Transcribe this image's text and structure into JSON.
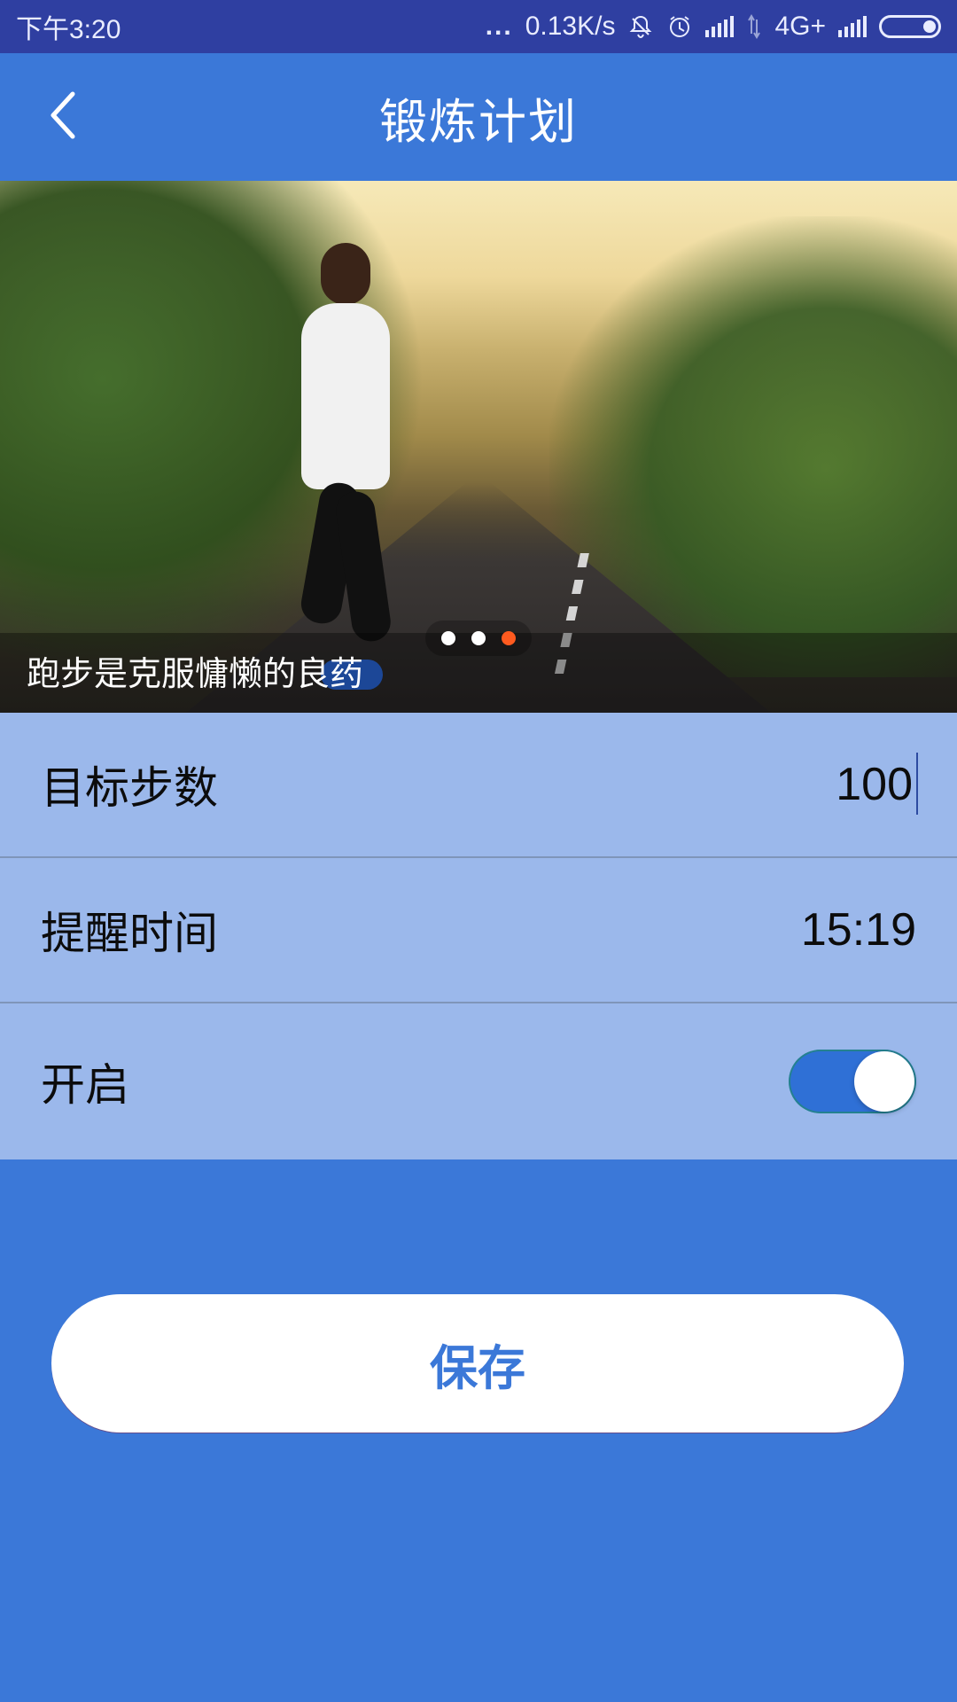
{
  "status_bar": {
    "time": "下午3:20",
    "more": "...",
    "speed": "0.13K/s",
    "network": "4G+"
  },
  "header": {
    "title": "锻炼计划"
  },
  "banner": {
    "caption": "跑步是克服慵懒的良药",
    "page_count": 3,
    "active_page_index": 2
  },
  "settings": {
    "target_steps": {
      "label": "目标步数",
      "value": "100"
    },
    "reminder_time": {
      "label": "提醒时间",
      "value": "15:19"
    },
    "enable": {
      "label": "开启",
      "on": true
    }
  },
  "actions": {
    "save_label": "保存"
  },
  "colors": {
    "status_bar": "#2f3fa1",
    "primary": "#3b78d8",
    "settings_bg": "#9bb8eb",
    "pager_active": "#ff5a1f"
  },
  "icons": {
    "back": "chevron-left-icon",
    "mute": "bell-off-icon",
    "alarm": "alarm-clock-icon",
    "signal": "signal-icon",
    "battery": "battery-icon"
  }
}
